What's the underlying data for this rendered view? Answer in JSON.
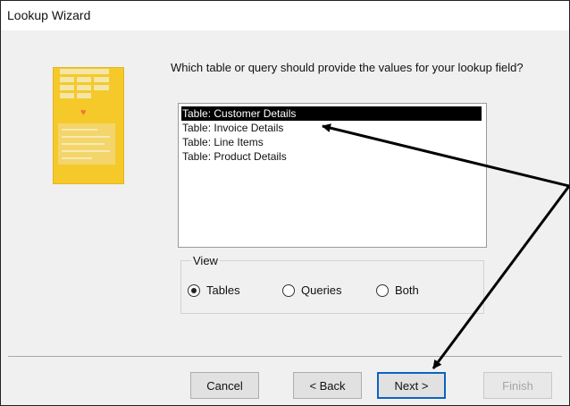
{
  "window": {
    "title": "Lookup Wizard"
  },
  "prompt": "Which table or query should provide the values for your lookup field?",
  "list": {
    "items": [
      {
        "label": "Table: Customer Details",
        "selected": true
      },
      {
        "label": "Table: Invoice Details",
        "selected": false
      },
      {
        "label": "Table: Line Items",
        "selected": false
      },
      {
        "label": "Table: Product Details",
        "selected": false
      }
    ]
  },
  "view": {
    "label": "View",
    "options": [
      {
        "label": "Tables",
        "checked": true
      },
      {
        "label": "Queries",
        "checked": false
      },
      {
        "label": "Both",
        "checked": false
      }
    ]
  },
  "buttons": {
    "cancel": "Cancel",
    "back": "< Back",
    "next": "Next >",
    "finish": "Finish"
  },
  "colors": {
    "illustration": "#f6c92a",
    "selection": "#000000",
    "default_button_border": "#0a64c2"
  }
}
